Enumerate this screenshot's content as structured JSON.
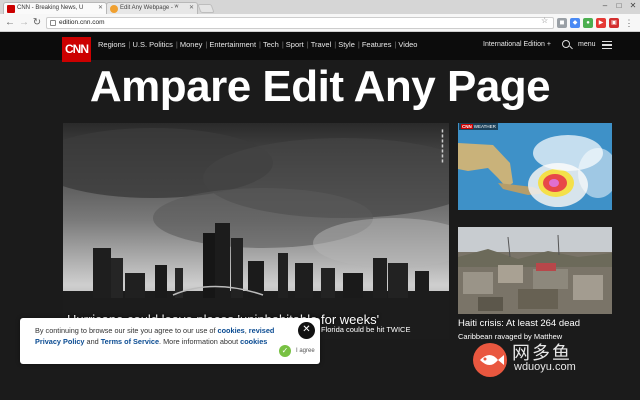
{
  "browser": {
    "tabs": [
      {
        "title": "CNN - Breaking News, U",
        "favicon_color": "#cc0000"
      },
      {
        "title": "Edit Any Webpage - ᵂ",
        "favicon_color": "#f0a030"
      }
    ],
    "address": "edition.cnn.com"
  },
  "nav": {
    "logo": "CNN",
    "sections": [
      "Regions",
      "U.S. Politics",
      "Money",
      "Entertainment",
      "Tech",
      "Sport",
      "Travel",
      "Style",
      "Features",
      "Video"
    ],
    "edition": "International Edition +",
    "menu_label": "menu"
  },
  "overlay_title": "Ampare Edit Any Page",
  "main_story": {
    "headline": "Hurricane could leave places 'uninhabitable for weeks'",
    "subheadline": "Florida could be hit TWICE"
  },
  "weather_story": {
    "badge_logo": "CNN",
    "badge_text": "WEATHER"
  },
  "haiti_story": {
    "headline": "Haiti crisis: At least 264 dead",
    "subheadline": "Caribbean ravaged by Matthew"
  },
  "cookie_banner": {
    "text_1": "By continuing to browse our site you agree to our use of",
    "link_cookies": "cookies",
    "text_2": ",",
    "link_privacy": "revised Privacy Policy",
    "text_3": "and",
    "link_terms": "Terms of Service",
    "text_4": ". More information about",
    "link_cookies_2": "cookies",
    "agree_label": "I agree",
    "close_glyph": "✕"
  },
  "watermark": {
    "text_cn": "网多鱼",
    "url": "wduoyu.com"
  },
  "colors": {
    "cnn_red": "#cc0000",
    "nav_bg": "#0c0c0c",
    "page_bg": "#1b1b1b",
    "link_blue": "#0a4b92",
    "agree_green": "#78c143"
  }
}
